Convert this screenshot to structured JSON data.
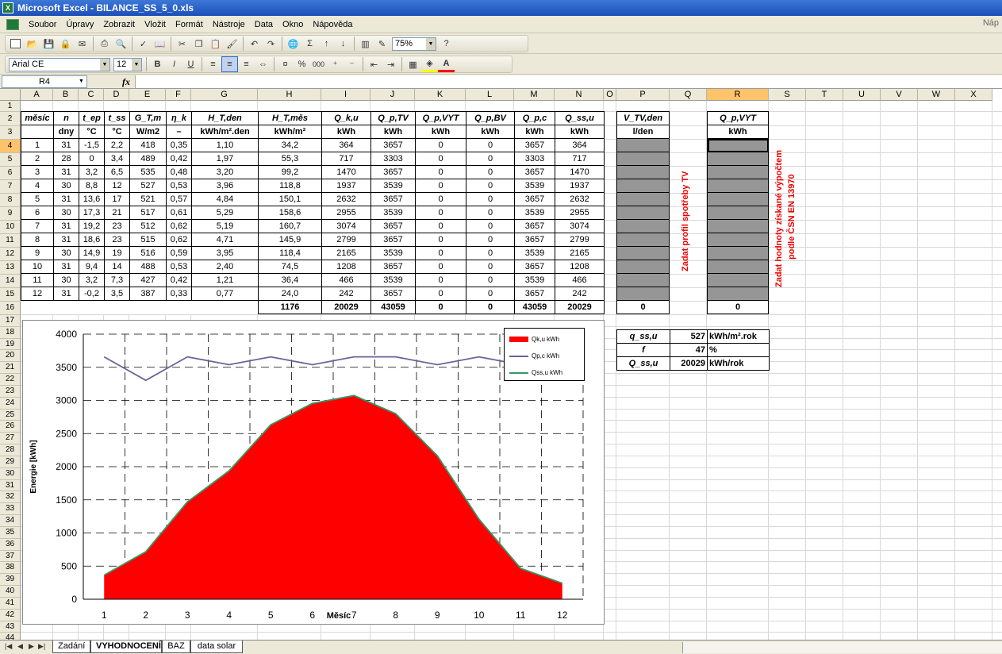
{
  "window": {
    "title": "Microsoft Excel - BILANCE_SS_5_0.xls"
  },
  "menu": {
    "items": [
      "Soubor",
      "Úpravy",
      "Zobrazit",
      "Vložit",
      "Formát",
      "Nástroje",
      "Data",
      "Okno",
      "Nápověda"
    ],
    "help_placeholder": "Náp"
  },
  "toolbar": {
    "zoom": "75%",
    "font_name": "Arial CE",
    "font_size": "12",
    "bold": "B",
    "italic": "I",
    "underline": "U",
    "percent": "%",
    "thousands": "000",
    "sigma": "Σ"
  },
  "formula_bar": {
    "name_box": "R4",
    "fx": "fx",
    "value": ""
  },
  "columns": [
    "A",
    "B",
    "C",
    "D",
    "E",
    "F",
    "G",
    "H",
    "I",
    "J",
    "K",
    "L",
    "M",
    "N",
    "O",
    "P",
    "Q",
    "R",
    "S",
    "T",
    "U",
    "V",
    "W",
    "X"
  ],
  "selected_column": "R",
  "selected_row": "4",
  "main_table": {
    "header1": [
      "měsíc",
      "n",
      "t_ep",
      "t_ss",
      "G_T,m",
      "η_k",
      "H_T,den",
      "H_T,měs",
      "Q_k,u",
      "Q_p,TV",
      "Q_p,VYT",
      "Q_p,BV",
      "Q_p,c",
      "Q_ss,u"
    ],
    "header2": [
      "",
      "dny",
      "°C",
      "°C",
      "W/m2",
      "–",
      "kWh/m².den",
      "kWh/m²",
      "kWh",
      "kWh",
      "kWh",
      "kWh",
      "kWh",
      "kWh"
    ],
    "rows": [
      [
        "1",
        "31",
        "-1,5",
        "2,2",
        "418",
        "0,35",
        "1,10",
        "34,2",
        "364",
        "3657",
        "0",
        "0",
        "3657",
        "364"
      ],
      [
        "2",
        "28",
        "0",
        "3,4",
        "489",
        "0,42",
        "1,97",
        "55,3",
        "717",
        "3303",
        "0",
        "0",
        "3303",
        "717"
      ],
      [
        "3",
        "31",
        "3,2",
        "6,5",
        "535",
        "0,48",
        "3,20",
        "99,2",
        "1470",
        "3657",
        "0",
        "0",
        "3657",
        "1470"
      ],
      [
        "4",
        "30",
        "8,8",
        "12",
        "527",
        "0,53",
        "3,96",
        "118,8",
        "1937",
        "3539",
        "0",
        "0",
        "3539",
        "1937"
      ],
      [
        "5",
        "31",
        "13,6",
        "17",
        "521",
        "0,57",
        "4,84",
        "150,1",
        "2632",
        "3657",
        "0",
        "0",
        "3657",
        "2632"
      ],
      [
        "6",
        "30",
        "17,3",
        "21",
        "517",
        "0,61",
        "5,29",
        "158,6",
        "2955",
        "3539",
        "0",
        "0",
        "3539",
        "2955"
      ],
      [
        "7",
        "31",
        "19,2",
        "23",
        "512",
        "0,62",
        "5,19",
        "160,7",
        "3074",
        "3657",
        "0",
        "0",
        "3657",
        "3074"
      ],
      [
        "8",
        "31",
        "18,6",
        "23",
        "515",
        "0,62",
        "4,71",
        "145,9",
        "2799",
        "3657",
        "0",
        "0",
        "3657",
        "2799"
      ],
      [
        "9",
        "30",
        "14,9",
        "19",
        "516",
        "0,59",
        "3,95",
        "118,4",
        "2165",
        "3539",
        "0",
        "0",
        "3539",
        "2165"
      ],
      [
        "10",
        "31",
        "9,4",
        "14",
        "488",
        "0,53",
        "2,40",
        "74,5",
        "1208",
        "3657",
        "0",
        "0",
        "3657",
        "1208"
      ],
      [
        "11",
        "30",
        "3,2",
        "7,3",
        "427",
        "0,42",
        "1,21",
        "36,4",
        "466",
        "3539",
        "0",
        "0",
        "3539",
        "466"
      ],
      [
        "12",
        "31",
        "-0,2",
        "3,5",
        "387",
        "0,33",
        "0,77",
        "24,0",
        "242",
        "3657",
        "0",
        "0",
        "3657",
        "242"
      ]
    ],
    "totals": [
      "1176",
      "20029",
      "43059",
      "0",
      "0",
      "43059",
      "20029"
    ]
  },
  "tv_table": {
    "header1": "V_TV,den",
    "header2": "l/den",
    "total": "0"
  },
  "vyt_table": {
    "header1": "Q_p,VYT",
    "header2": "kWh",
    "total": "0"
  },
  "notes": {
    "tv": "Zadat  profil spotřeby TV",
    "vyt_line1": "Zadat hodnoty získané výpočtem",
    "vyt_line2": "podle ČSN EN 13970"
  },
  "summary_table": {
    "rows": [
      {
        "label": "q_ss,u",
        "value": "527",
        "unit": "kWh/m².rok"
      },
      {
        "label": "f",
        "value": "47",
        "unit": "%"
      },
      {
        "label": "Q_ss,u",
        "value": "20029",
        "unit": "kWh/rok"
      }
    ]
  },
  "chart_data": {
    "type": "area",
    "x": [
      1,
      2,
      3,
      4,
      5,
      6,
      7,
      8,
      9,
      10,
      11,
      12
    ],
    "series": [
      {
        "name": "Qk,u kWh",
        "kind": "area",
        "color": "#ff0000",
        "values": [
          364,
          717,
          1470,
          1937,
          2632,
          2955,
          3074,
          2799,
          2165,
          1208,
          466,
          242
        ]
      },
      {
        "name": "Qp,c kWh",
        "kind": "line",
        "color": "#666699",
        "values": [
          3657,
          3303,
          3657,
          3539,
          3657,
          3539,
          3657,
          3657,
          3539,
          3657,
          3539,
          3657
        ]
      },
      {
        "name": "Qss,u kWh",
        "kind": "line",
        "color": "#339966",
        "values": [
          364,
          717,
          1470,
          1937,
          2632,
          2955,
          3074,
          2799,
          2165,
          1208,
          466,
          242
        ]
      }
    ],
    "xlabel": "Měsíc",
    "ylabel": "Energie  [kWh]",
    "ylim": [
      0,
      4000
    ],
    "yticks": [
      0,
      500,
      1000,
      1500,
      2000,
      2500,
      3000,
      3500,
      4000
    ],
    "grid": true,
    "legend": "top-right"
  },
  "sheet_tabs": [
    "Zadání",
    "VYHODNOCENÍ",
    "BAZ",
    "data solar"
  ],
  "active_tab": "VYHODNOCENÍ"
}
